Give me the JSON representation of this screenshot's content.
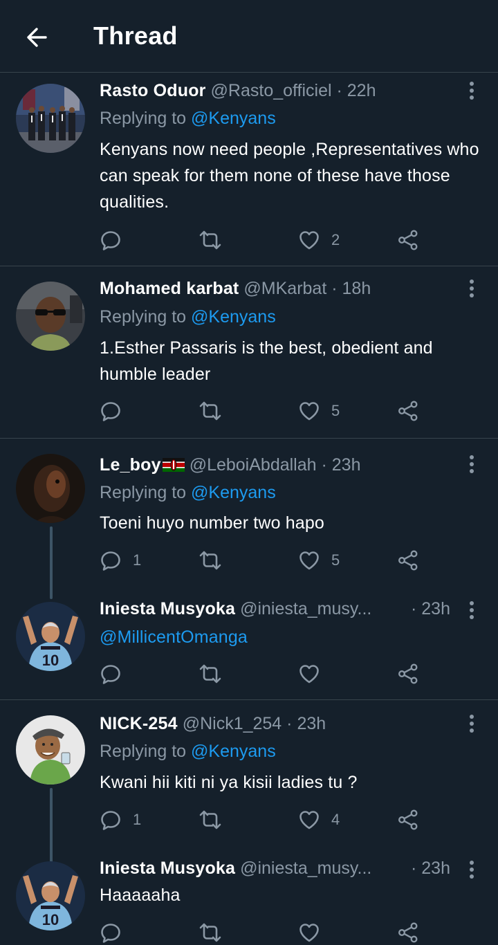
{
  "header": {
    "title": "Thread"
  },
  "tweets": [
    {
      "name": "Rasto Oduor",
      "handle": "@Rasto_officiel",
      "time": "· 22h",
      "replying_prefix": "Replying to ",
      "replying_to": "@Kenyans",
      "text": "Kenyans now need people ,Representatives who can speak for them none of these  have those qualities.",
      "replies": "",
      "likes": "2"
    },
    {
      "name": "Mohamed karbat",
      "handle": "@MKarbat",
      "time": "· 18h",
      "replying_prefix": "Replying to ",
      "replying_to": "@Kenyans",
      "text": "1.Esther Passaris is the best, obedient and humble leader",
      "replies": "",
      "likes": "5"
    },
    {
      "name": "Le_boy",
      "flag": "kenya-flag-emoji",
      "handle": "@LeboiAbdallah",
      "time": "· 23h",
      "replying_prefix": "Replying to ",
      "replying_to": "@Kenyans",
      "text": "Toeni huyo number two hapo",
      "replies": "1",
      "likes": "5"
    },
    {
      "name": "Iniesta Musyoka",
      "handle": "@iniesta_musy...",
      "time": "· 23h",
      "mention": "@MillicentOmanga",
      "replies": "",
      "likes": ""
    },
    {
      "name": "NICK-254",
      "handle": "@Nick1_254",
      "time": "· 23h",
      "replying_prefix": "Replying to ",
      "replying_to": "@Kenyans",
      "text": "Kwani hii kiti ni ya kisii ladies tu ?",
      "replies": "1",
      "likes": "4"
    },
    {
      "name": "Iniesta Musyoka",
      "handle": "@iniesta_musy...",
      "time": "· 23h",
      "text": "Haaaaaha",
      "replies": "",
      "likes": ""
    }
  ],
  "colors": {
    "background": "#15202b",
    "link": "#1d9bf0",
    "muted": "#8b98a5",
    "divider": "#38444d"
  },
  "icons": [
    "back-arrow-icon",
    "more-vertical-icon",
    "reply-icon",
    "retweet-icon",
    "like-heart-icon",
    "share-icon"
  ]
}
